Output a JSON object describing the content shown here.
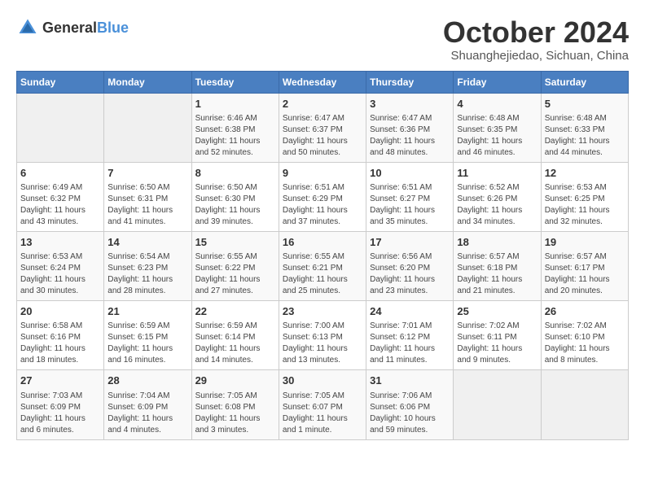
{
  "header": {
    "logo_general": "General",
    "logo_blue": "Blue",
    "month": "October 2024",
    "location": "Shuanghejiedao, Sichuan, China"
  },
  "days_of_week": [
    "Sunday",
    "Monday",
    "Tuesday",
    "Wednesday",
    "Thursday",
    "Friday",
    "Saturday"
  ],
  "weeks": [
    [
      {
        "day": "",
        "info": ""
      },
      {
        "day": "",
        "info": ""
      },
      {
        "day": "1",
        "info": "Sunrise: 6:46 AM\nSunset: 6:38 PM\nDaylight: 11 hours and 52 minutes."
      },
      {
        "day": "2",
        "info": "Sunrise: 6:47 AM\nSunset: 6:37 PM\nDaylight: 11 hours and 50 minutes."
      },
      {
        "day": "3",
        "info": "Sunrise: 6:47 AM\nSunset: 6:36 PM\nDaylight: 11 hours and 48 minutes."
      },
      {
        "day": "4",
        "info": "Sunrise: 6:48 AM\nSunset: 6:35 PM\nDaylight: 11 hours and 46 minutes."
      },
      {
        "day": "5",
        "info": "Sunrise: 6:48 AM\nSunset: 6:33 PM\nDaylight: 11 hours and 44 minutes."
      }
    ],
    [
      {
        "day": "6",
        "info": "Sunrise: 6:49 AM\nSunset: 6:32 PM\nDaylight: 11 hours and 43 minutes."
      },
      {
        "day": "7",
        "info": "Sunrise: 6:50 AM\nSunset: 6:31 PM\nDaylight: 11 hours and 41 minutes."
      },
      {
        "day": "8",
        "info": "Sunrise: 6:50 AM\nSunset: 6:30 PM\nDaylight: 11 hours and 39 minutes."
      },
      {
        "day": "9",
        "info": "Sunrise: 6:51 AM\nSunset: 6:29 PM\nDaylight: 11 hours and 37 minutes."
      },
      {
        "day": "10",
        "info": "Sunrise: 6:51 AM\nSunset: 6:27 PM\nDaylight: 11 hours and 35 minutes."
      },
      {
        "day": "11",
        "info": "Sunrise: 6:52 AM\nSunset: 6:26 PM\nDaylight: 11 hours and 34 minutes."
      },
      {
        "day": "12",
        "info": "Sunrise: 6:53 AM\nSunset: 6:25 PM\nDaylight: 11 hours and 32 minutes."
      }
    ],
    [
      {
        "day": "13",
        "info": "Sunrise: 6:53 AM\nSunset: 6:24 PM\nDaylight: 11 hours and 30 minutes."
      },
      {
        "day": "14",
        "info": "Sunrise: 6:54 AM\nSunset: 6:23 PM\nDaylight: 11 hours and 28 minutes."
      },
      {
        "day": "15",
        "info": "Sunrise: 6:55 AM\nSunset: 6:22 PM\nDaylight: 11 hours and 27 minutes."
      },
      {
        "day": "16",
        "info": "Sunrise: 6:55 AM\nSunset: 6:21 PM\nDaylight: 11 hours and 25 minutes."
      },
      {
        "day": "17",
        "info": "Sunrise: 6:56 AM\nSunset: 6:20 PM\nDaylight: 11 hours and 23 minutes."
      },
      {
        "day": "18",
        "info": "Sunrise: 6:57 AM\nSunset: 6:18 PM\nDaylight: 11 hours and 21 minutes."
      },
      {
        "day": "19",
        "info": "Sunrise: 6:57 AM\nSunset: 6:17 PM\nDaylight: 11 hours and 20 minutes."
      }
    ],
    [
      {
        "day": "20",
        "info": "Sunrise: 6:58 AM\nSunset: 6:16 PM\nDaylight: 11 hours and 18 minutes."
      },
      {
        "day": "21",
        "info": "Sunrise: 6:59 AM\nSunset: 6:15 PM\nDaylight: 11 hours and 16 minutes."
      },
      {
        "day": "22",
        "info": "Sunrise: 6:59 AM\nSunset: 6:14 PM\nDaylight: 11 hours and 14 minutes."
      },
      {
        "day": "23",
        "info": "Sunrise: 7:00 AM\nSunset: 6:13 PM\nDaylight: 11 hours and 13 minutes."
      },
      {
        "day": "24",
        "info": "Sunrise: 7:01 AM\nSunset: 6:12 PM\nDaylight: 11 hours and 11 minutes."
      },
      {
        "day": "25",
        "info": "Sunrise: 7:02 AM\nSunset: 6:11 PM\nDaylight: 11 hours and 9 minutes."
      },
      {
        "day": "26",
        "info": "Sunrise: 7:02 AM\nSunset: 6:10 PM\nDaylight: 11 hours and 8 minutes."
      }
    ],
    [
      {
        "day": "27",
        "info": "Sunrise: 7:03 AM\nSunset: 6:09 PM\nDaylight: 11 hours and 6 minutes."
      },
      {
        "day": "28",
        "info": "Sunrise: 7:04 AM\nSunset: 6:09 PM\nDaylight: 11 hours and 4 minutes."
      },
      {
        "day": "29",
        "info": "Sunrise: 7:05 AM\nSunset: 6:08 PM\nDaylight: 11 hours and 3 minutes."
      },
      {
        "day": "30",
        "info": "Sunrise: 7:05 AM\nSunset: 6:07 PM\nDaylight: 11 hours and 1 minute."
      },
      {
        "day": "31",
        "info": "Sunrise: 7:06 AM\nSunset: 6:06 PM\nDaylight: 10 hours and 59 minutes."
      },
      {
        "day": "",
        "info": ""
      },
      {
        "day": "",
        "info": ""
      }
    ]
  ]
}
